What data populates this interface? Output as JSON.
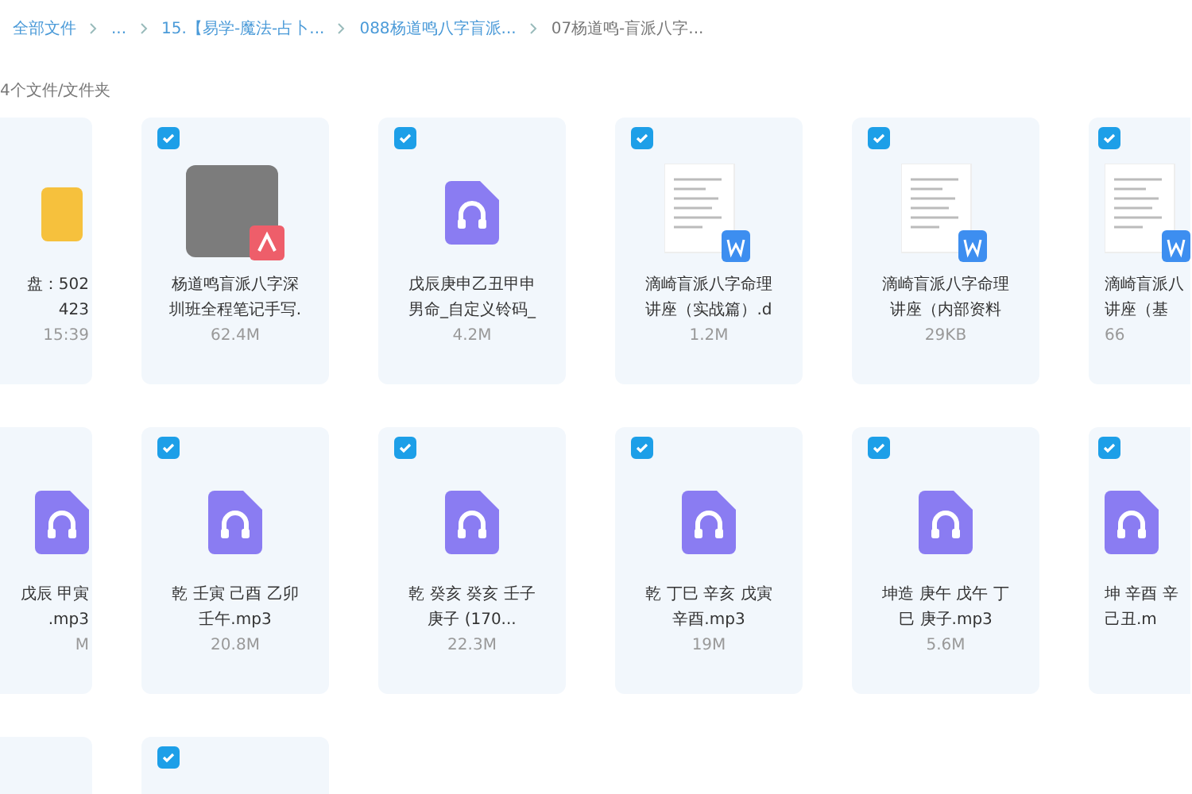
{
  "breadcrumb": [
    {
      "label": "全部文件"
    },
    {
      "label": "..."
    },
    {
      "label": "15.【易学-魔法-占卜..."
    },
    {
      "label": "088杨道鸣八字盲派..."
    },
    {
      "label": "07杨道鸣-盲派八字..."
    }
  ],
  "file_count": "4个文件/文件夹",
  "rows": [
    [
      {
        "kind": "folder",
        "name_lines": [
          "盘：502",
          "423"
        ],
        "meta": "15:39"
      },
      {
        "kind": "pdf",
        "checked": true,
        "name_lines": [
          "杨道鸣盲派八字深",
          "圳班全程笔记手写."
        ],
        "meta": "62.4M"
      },
      {
        "kind": "audio",
        "checked": true,
        "name_lines": [
          "戊辰庚申乙丑甲申",
          "男命_自定义铃码_"
        ],
        "meta": "4.2M"
      },
      {
        "kind": "doc",
        "checked": true,
        "name_lines": [
          "滴崎盲派八字命理",
          "讲座（实战篇）.d"
        ],
        "meta": "1.2M"
      },
      {
        "kind": "doc",
        "checked": true,
        "name_lines": [
          "滴崎盲派八字命理",
          "讲座（内部资料"
        ],
        "meta": "29KB"
      },
      {
        "kind": "doc",
        "checked": true,
        "name_lines": [
          "滴崎盲派八",
          "讲座（基"
        ],
        "meta": "66"
      }
    ],
    [
      {
        "kind": "audio",
        "name_lines": [
          "戊辰 甲寅",
          ".mp3"
        ],
        "meta": "M"
      },
      {
        "kind": "audio",
        "checked": true,
        "name_lines": [
          "乾 壬寅 己酉 乙卯",
          "壬午.mp3"
        ],
        "meta": "20.8M"
      },
      {
        "kind": "audio",
        "checked": true,
        "name_lines": [
          "乾 癸亥 癸亥 壬子",
          "庚子 (170..."
        ],
        "meta": "22.3M"
      },
      {
        "kind": "audio",
        "checked": true,
        "name_lines": [
          "乾 丁巳 辛亥 戊寅",
          "辛酉.mp3"
        ],
        "meta": "19M"
      },
      {
        "kind": "audio",
        "checked": true,
        "name_lines": [
          "坤造 庚午 戊午 丁",
          "巳 庚子.mp3"
        ],
        "meta": "5.6M"
      },
      {
        "kind": "audio",
        "checked": true,
        "name_lines": [
          "坤 辛酉 辛",
          "己丑.m"
        ]
      }
    ],
    [
      {
        "kind": "blank"
      },
      {
        "kind": "blank",
        "checked": true
      }
    ]
  ]
}
